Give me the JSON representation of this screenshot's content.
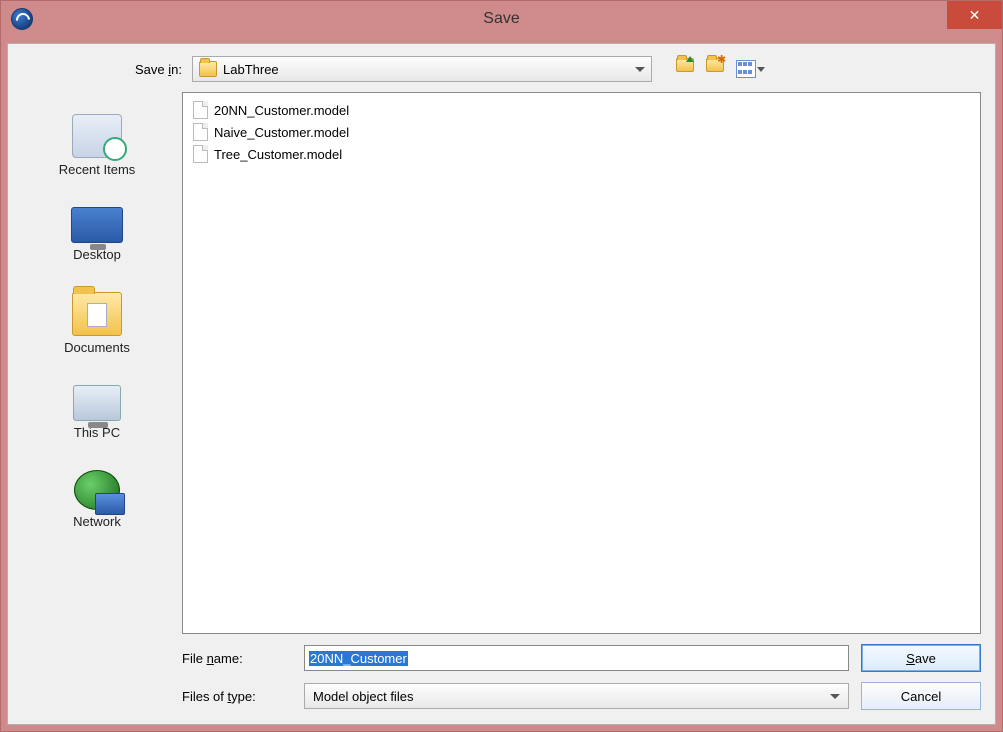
{
  "window": {
    "title": "Save",
    "close_glyph": "✕"
  },
  "savein": {
    "label": "Save in:",
    "value": "LabThree"
  },
  "toolbar_icons": {
    "up": "up-one-level-icon",
    "new_folder": "new-folder-icon",
    "view": "view-menu-icon"
  },
  "places": [
    {
      "id": "recent",
      "label": "Recent Items"
    },
    {
      "id": "desktop",
      "label": "Desktop"
    },
    {
      "id": "documents",
      "label": "Documents"
    },
    {
      "id": "thispc",
      "label": "This PC"
    },
    {
      "id": "network",
      "label": "Network"
    }
  ],
  "files": [
    {
      "name": "20NN_Customer.model"
    },
    {
      "name": "Naive_Customer.model"
    },
    {
      "name": "Tree_Customer.model"
    }
  ],
  "filename": {
    "label": "File name:",
    "mnemonic_index": 5,
    "value": "20NN_Customer",
    "selected": true
  },
  "filetype": {
    "label": "Files of type:",
    "mnemonic_index": 9,
    "value": "Model object files"
  },
  "buttons": {
    "save": "Save",
    "save_mnemonic_index": 0,
    "cancel": "Cancel"
  }
}
